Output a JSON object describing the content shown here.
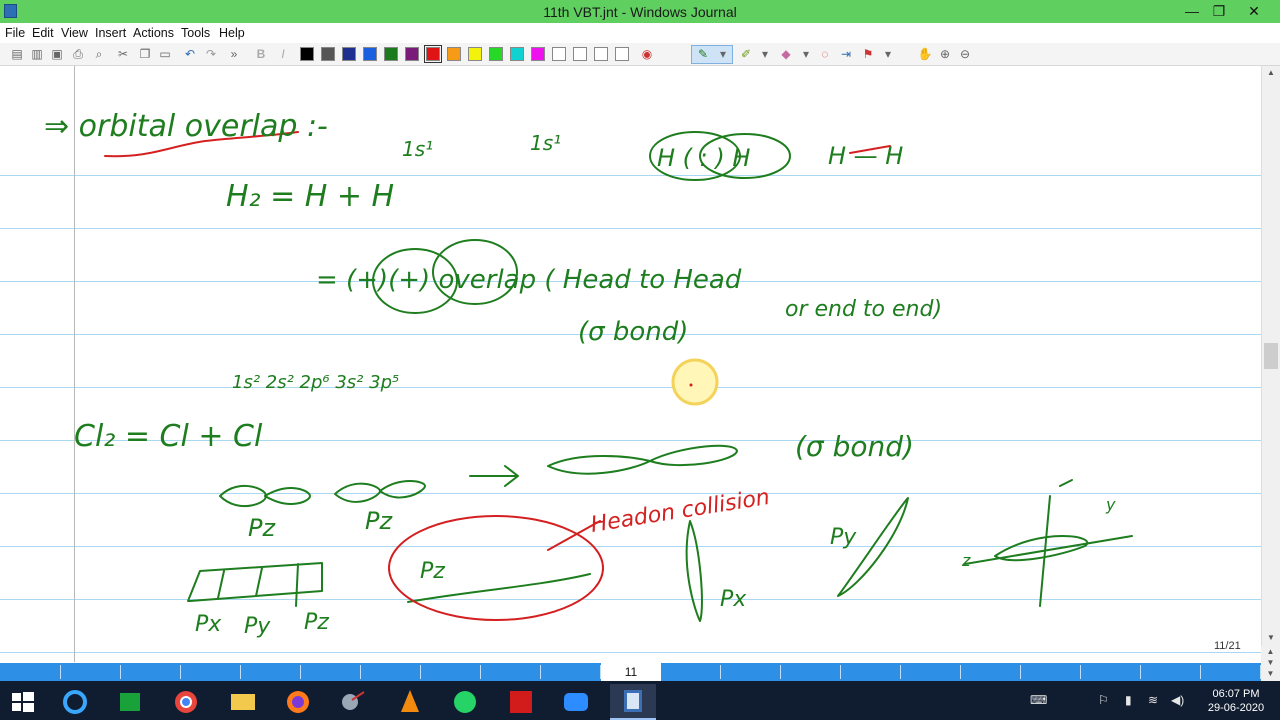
{
  "window": {
    "title": "11th VBT.jnt - Windows Journal",
    "minimize": "—",
    "maximize": "❐",
    "close": "✕"
  },
  "menu": [
    "File",
    "Edit",
    "View",
    "Insert",
    "Actions",
    "Tools",
    "Help"
  ],
  "toolbar": {
    "bold": "B",
    "italic": "I",
    "colors": [
      "#000000",
      "#555555",
      "#1f2f8f",
      "#1a5fe0",
      "#1b7a1b",
      "#7a1b7a",
      "#e01414",
      "#f79b16",
      "#f2f20c",
      "#27d827",
      "#12d1d1",
      "#ee12ee",
      "#ffffff",
      "#ffffff",
      "#ffffff",
      "#ffffff"
    ],
    "selected_color": "#e01414",
    "tool_icons": [
      "new-page-icon",
      "new-note-icon",
      "save-icon",
      "print-icon",
      "find-icon",
      "cut-icon",
      "copy-icon",
      "paste-icon",
      "undo-icon",
      "redo-icon",
      "pen-icon",
      "highlighter-icon",
      "eraser-icon",
      "lasso-icon",
      "insert-space-icon",
      "flag-icon",
      "pan-icon",
      "zoom-in-icon",
      "zoom-out-icon"
    ]
  },
  "ink": {
    "line1_a": "⇒ orbital overlap :-",
    "h2_eq": "H₂  =  H  +  H",
    "one_s_1": "1s¹",
    "one_s_2": "1s¹",
    "h_h_overlap": "H ( : ) H",
    "h_h_bond": "H — H",
    "overlap_line": "=  (+)(+)  overlap ( Head to Head",
    "sigma_bond_1": "(σ bond)",
    "or_end": "or end to end)",
    "cl_config": "1s² 2s² 2p⁶ 3s² 3p⁵",
    "cl2_eq": "Cl₂  =  Cl  +  Cl",
    "sigma_bond_2": "(σ bond)",
    "pz_1": "Pz",
    "pz_2": "Pz",
    "px": "Px",
    "py": "Py",
    "pz": "Pz",
    "pz_red": "Pz",
    "headon": "Headon collision",
    "px_right": "Px",
    "py_right": "Py",
    "axis_y": "y",
    "axis_z": "z"
  },
  "status": {
    "page_count": "11/21",
    "current_page": "11"
  },
  "taskbar": {
    "apps": [
      "windows-start-icon",
      "internet-explorer-icon",
      "store-icon",
      "chrome-icon",
      "file-explorer-icon",
      "firefox-icon",
      "snipping-tool-icon",
      "vlc-icon",
      "whatsapp-icon",
      "acrobat-icon",
      "zoom-icon",
      "journal-icon"
    ],
    "time": "06:07 PM",
    "date": "29-06-2020"
  }
}
